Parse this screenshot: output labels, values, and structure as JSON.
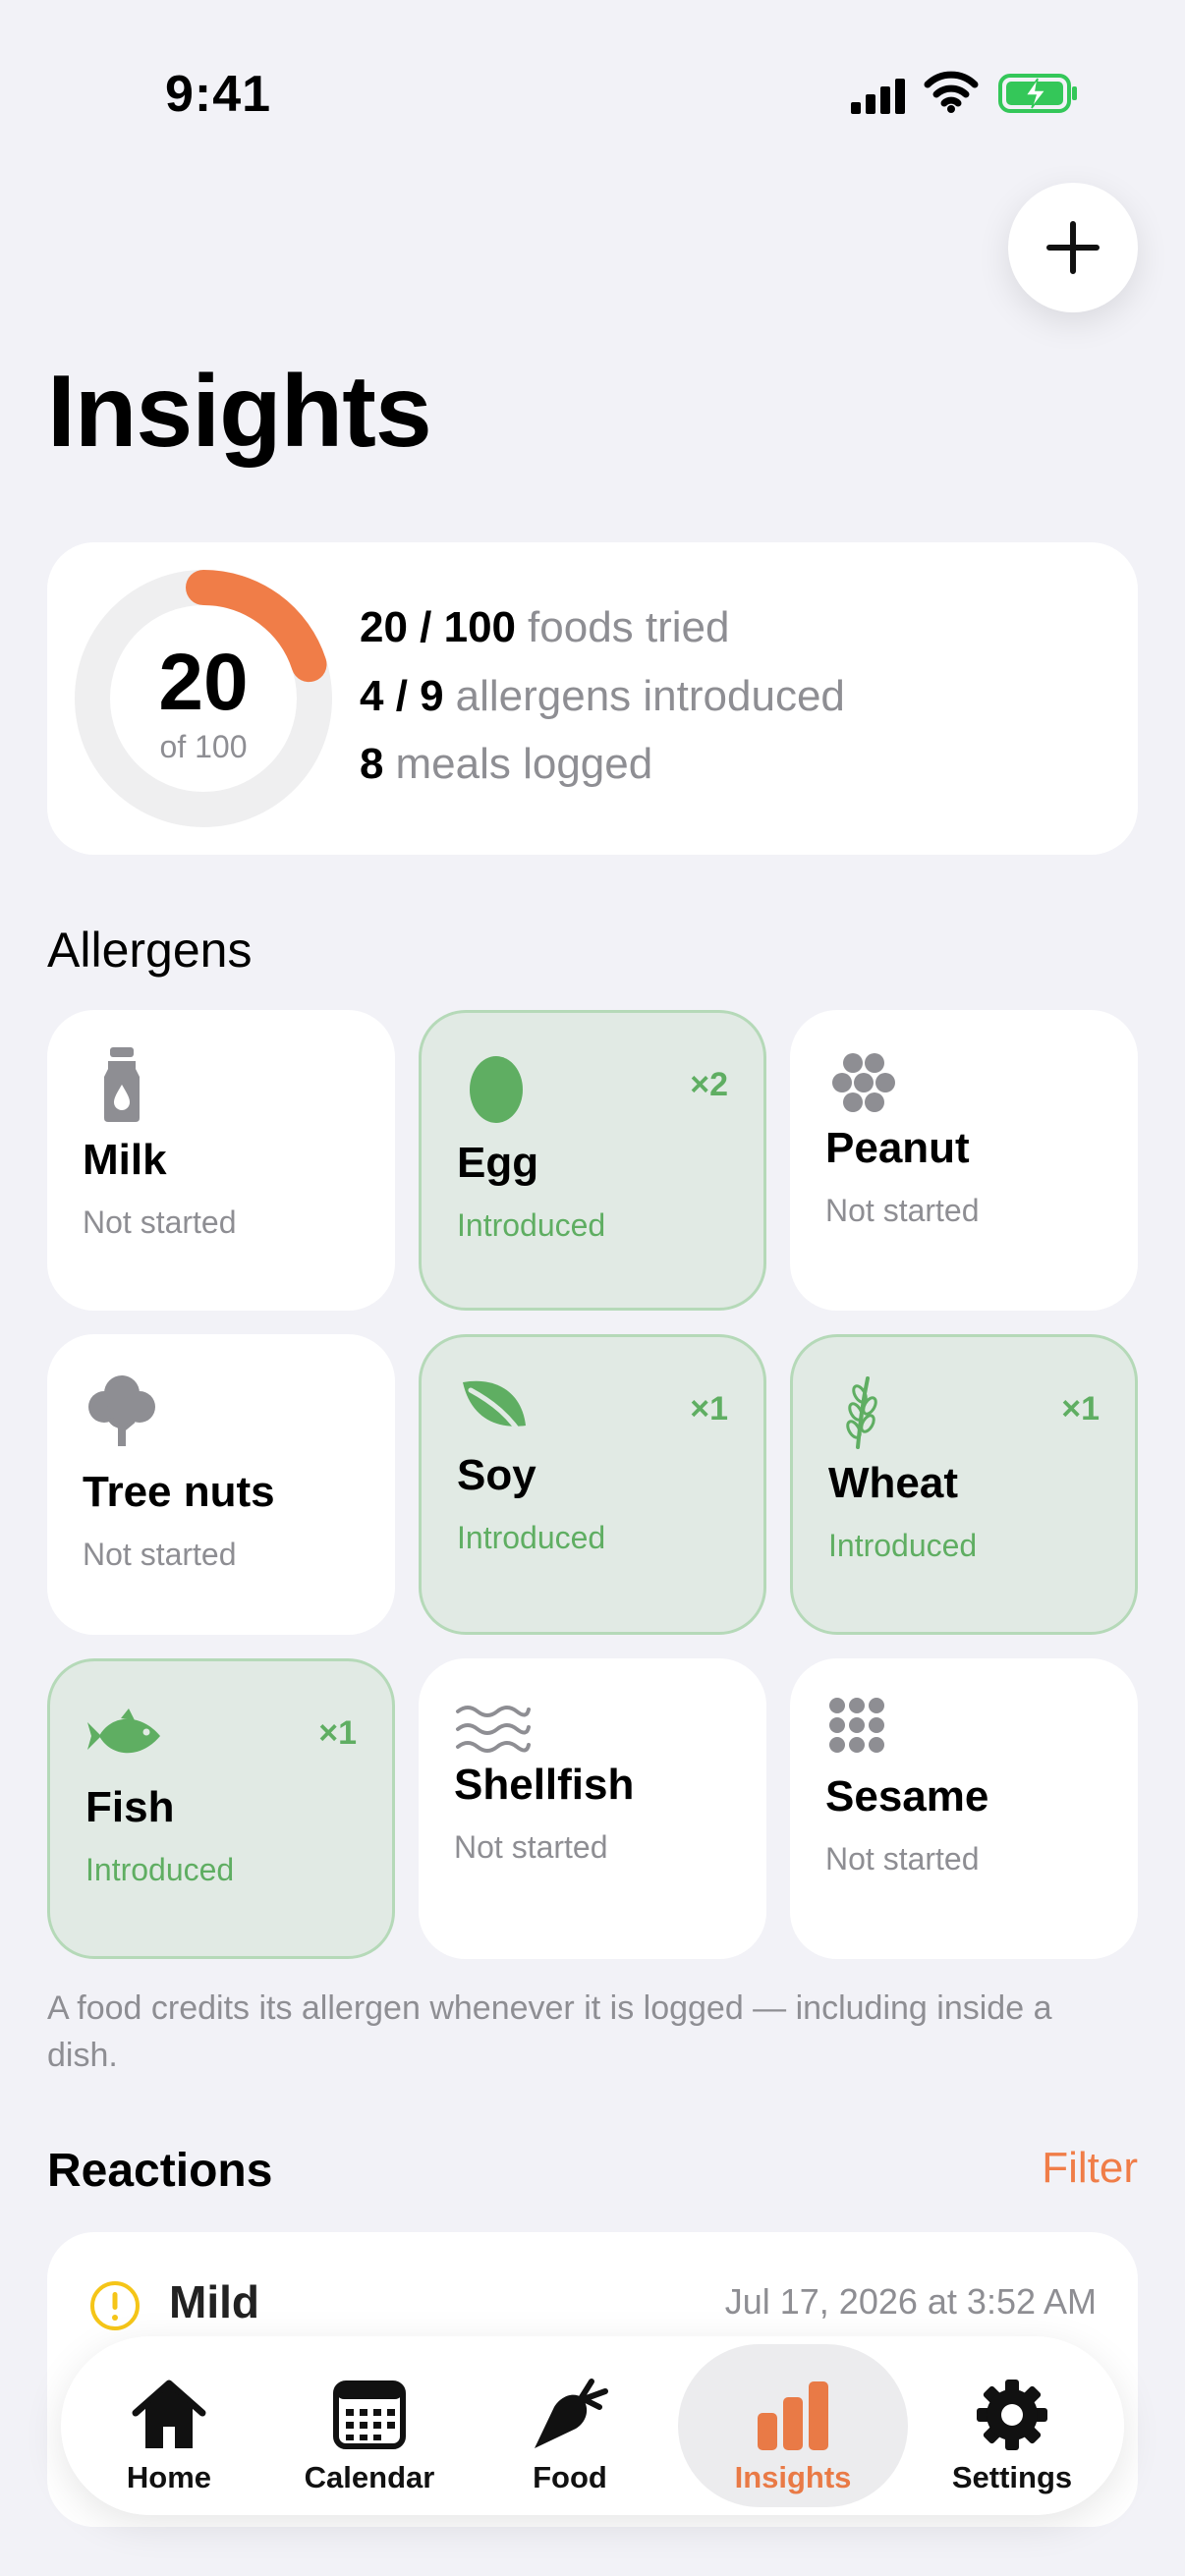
{
  "status_bar": {
    "time": "9:41"
  },
  "header": {
    "title": "Insights",
    "add_icon": "plus-icon"
  },
  "summary": {
    "ring_value": "20",
    "ring_sub": "of 100",
    "progress_fraction": 0.2,
    "accent_color": "#F07D48",
    "lines": [
      {
        "value": "20 / 100",
        "label": "foods tried"
      },
      {
        "value": "4 / 9",
        "label": "allergens introduced"
      },
      {
        "value": "8",
        "label": "meals logged"
      }
    ]
  },
  "allergens": {
    "title": "Allergens",
    "items": [
      {
        "name": "Milk",
        "status": "Not started",
        "count": "",
        "icon": "milk-bottle-icon"
      },
      {
        "name": "Egg",
        "status": "Introduced",
        "count": "×2",
        "icon": "egg-icon"
      },
      {
        "name": "Peanut",
        "status": "Not started",
        "count": "",
        "icon": "peanut-icon"
      },
      {
        "name": "Tree nuts",
        "status": "Not started",
        "count": "",
        "icon": "tree-icon"
      },
      {
        "name": "Soy",
        "status": "Introduced",
        "count": "×1",
        "icon": "leaf-icon"
      },
      {
        "name": "Wheat",
        "status": "Introduced",
        "count": "×1",
        "icon": "wheat-icon"
      },
      {
        "name": "Fish",
        "status": "Introduced",
        "count": "×1",
        "icon": "fish-icon"
      },
      {
        "name": "Shellfish",
        "status": "Not started",
        "count": "",
        "icon": "waves-icon"
      },
      {
        "name": "Sesame",
        "status": "Not started",
        "count": "",
        "icon": "sesame-dots-icon"
      }
    ],
    "footnote": "A food credits its allergen whenever it is logged — including inside a dish."
  },
  "reactions": {
    "title": "Reactions",
    "filter_label": "Filter",
    "items": [
      {
        "severity": "Mild",
        "date": "Jul 17, 2026 at 3:52 AM",
        "icon": "warning-circle-icon",
        "color": "#F5C518"
      }
    ]
  },
  "tabs": [
    {
      "label": "Home",
      "icon": "house-icon",
      "active": false
    },
    {
      "label": "Calendar",
      "icon": "calendar-icon",
      "active": false
    },
    {
      "label": "Food",
      "icon": "carrot-icon",
      "active": false
    },
    {
      "label": "Insights",
      "icon": "bar-chart-icon",
      "active": true
    },
    {
      "label": "Settings",
      "icon": "gear-icon",
      "active": false
    }
  ]
}
